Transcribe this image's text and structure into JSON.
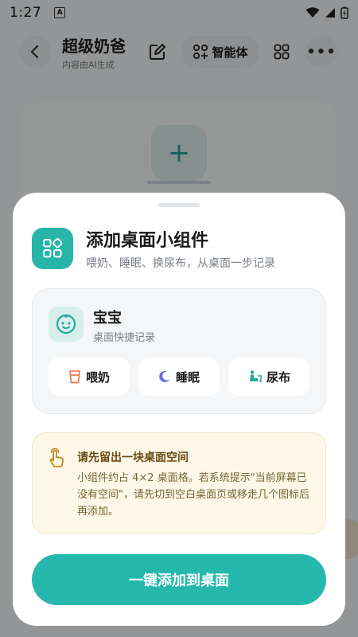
{
  "status_bar": {
    "time": "1:27",
    "notification_icon": "A"
  },
  "header": {
    "title": "超级奶爸",
    "subtitle": "内容由AI生成",
    "agent_label": "智能体",
    "more_label": "•••"
  },
  "background": {
    "add_label": "+"
  },
  "sheet": {
    "title": "添加桌面小组件",
    "subtitle": "喂奶、睡眠、换尿布，从桌面一步记录",
    "widget": {
      "name": "宝宝",
      "desc": "桌面快捷记录",
      "actions": [
        {
          "label": "喂奶",
          "icon": "bottle-icon"
        },
        {
          "label": "睡眠",
          "icon": "moon-icon"
        },
        {
          "label": "尿布",
          "icon": "diaper-icon"
        }
      ]
    },
    "notice": {
      "title": "请先留出一块桌面空间",
      "body": "小组件约占 4×2 桌面格。若系统提示\"当前屏幕已没有空间\"，请先切到空白桌面页或移走几个图标后再添加。"
    },
    "primary_button": "一键添加到桌面"
  },
  "colors": {
    "accent": "#26b8ad",
    "notice_bg": "#fdf8e8",
    "bottle": "#f07a5a",
    "moon": "#6a6ee0",
    "diaper": "#27a99e"
  }
}
